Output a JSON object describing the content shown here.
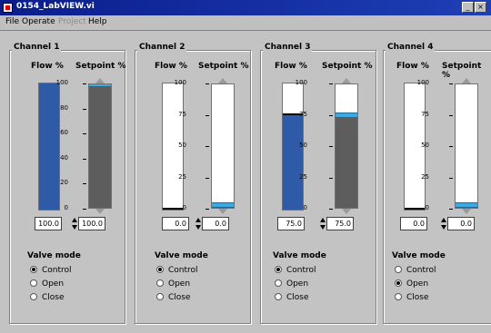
{
  "window": {
    "title": "0154_LabVIEW.vi"
  },
  "menu": [
    "File",
    "Operate",
    "Project",
    "Help"
  ],
  "scale_labels": [
    "100",
    "80",
    "60",
    "40",
    "20",
    "0"
  ],
  "channels": [
    {
      "name": "Channel 1",
      "flow_label": "Flow %",
      "setpoint_label": "Setpoint %",
      "flow": 100,
      "setpoint": 100,
      "flow_value": "100.0",
      "setpoint_value": "100.0",
      "scale": [
        "100",
        "80",
        "60",
        "40",
        "20",
        "0"
      ],
      "mode_title": "Valve mode",
      "modes": [
        "Control",
        "Open",
        "Close"
      ],
      "selected_mode": "Control"
    },
    {
      "name": "Channel 2",
      "flow_label": "Flow %",
      "setpoint_label": "Setpoint %",
      "flow": 0,
      "setpoint": 0,
      "flow_value": "0.0",
      "setpoint_value": "0.0",
      "scale": [
        "100",
        "75",
        "50",
        "25",
        "0"
      ],
      "mode_title": "Valve mode",
      "modes": [
        "Control",
        "Open",
        "Close"
      ],
      "selected_mode": "Control"
    },
    {
      "name": "Channel 3",
      "flow_label": "Flow %",
      "setpoint_label": "Setpoint %",
      "flow": 75,
      "setpoint": 75,
      "flow_value": "75.0",
      "setpoint_value": "75.0",
      "scale": [
        "100",
        "75",
        "50",
        "25",
        "0"
      ],
      "mode_title": "Valve mode",
      "modes": [
        "Control",
        "Open",
        "Close"
      ],
      "selected_mode": "Control"
    },
    {
      "name": "Channel 4",
      "flow_label": "Flow %",
      "setpoint_label": "Setpoint %",
      "flow": 0,
      "setpoint": 0,
      "flow_value": "0.0",
      "setpoint_value": "0.0",
      "scale": [
        "100",
        "75",
        "50",
        "25",
        "0"
      ],
      "mode_title": "Valve mode",
      "modes": [
        "Control",
        "Open",
        "Close"
      ],
      "selected_mode": "Open"
    }
  ],
  "colors": {
    "flow_fill": "#2f5aa8",
    "setpoint_fill": "#5d5d5d",
    "slider_thumb": "#3ea8e0",
    "title_bar": "#0a1d8c"
  }
}
